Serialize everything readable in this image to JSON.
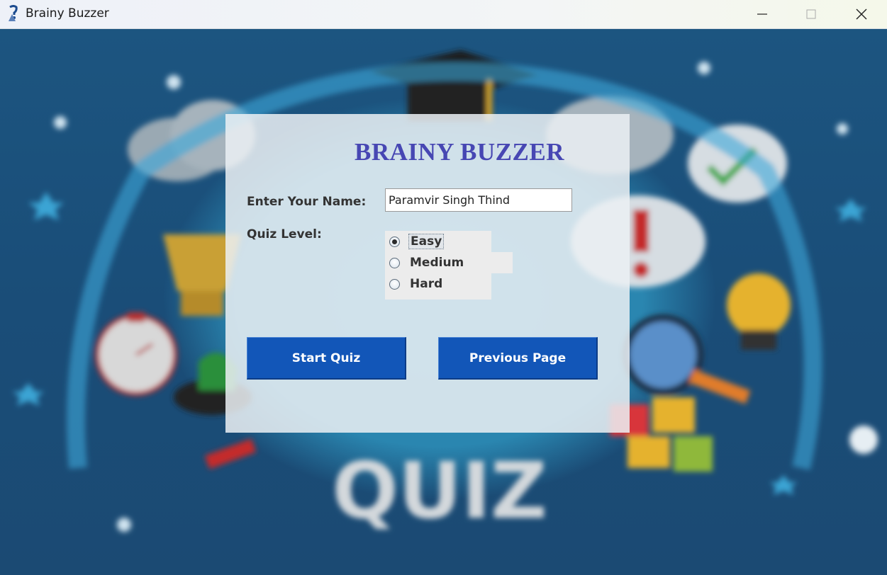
{
  "window": {
    "title": "Brainy Buzzer",
    "controls": {
      "minimize": "minimize",
      "maximize": "maximize",
      "close": "close"
    }
  },
  "form": {
    "heading": "BRAINY BUZZER",
    "name_label": "Enter Your Name:",
    "name_value": "Paramvir Singh Thind",
    "level_label": "Quiz Level:",
    "levels": [
      {
        "label": "Easy",
        "selected": true
      },
      {
        "label": "Medium",
        "selected": false
      },
      {
        "label": "Hard",
        "selected": false
      }
    ],
    "start_button": "Start Quiz",
    "previous_button": "Previous Page"
  },
  "background": {
    "banner_text": "QUIZ"
  },
  "colors": {
    "heading": "#4747b3",
    "button": "#1256b8",
    "background": "#1b4a73"
  }
}
